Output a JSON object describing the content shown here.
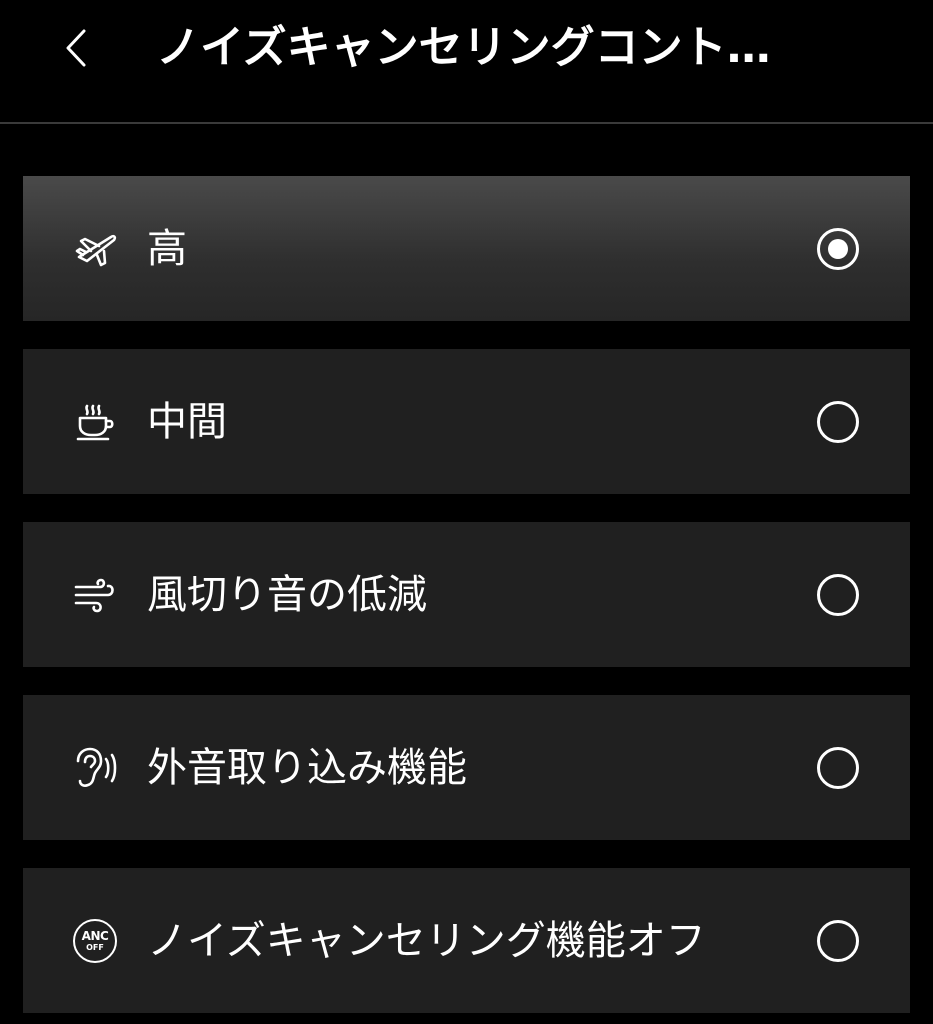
{
  "header": {
    "title": "ノイズキャンセリングコント…"
  },
  "options": [
    {
      "icon": "airplane-icon",
      "label": "高",
      "selected": true
    },
    {
      "icon": "coffee-cup-icon",
      "label": "中間",
      "selected": false
    },
    {
      "icon": "wind-icon",
      "label": "風切り音の低減",
      "selected": false
    },
    {
      "icon": "ear-sound-icon",
      "label": "外音取り込み機能",
      "selected": false
    },
    {
      "icon": "anc-off-icon",
      "label": "ノイズキャンセリング機能オフ",
      "selected": false,
      "badge_top": "ANC",
      "badge_bottom": "OFF"
    }
  ]
}
